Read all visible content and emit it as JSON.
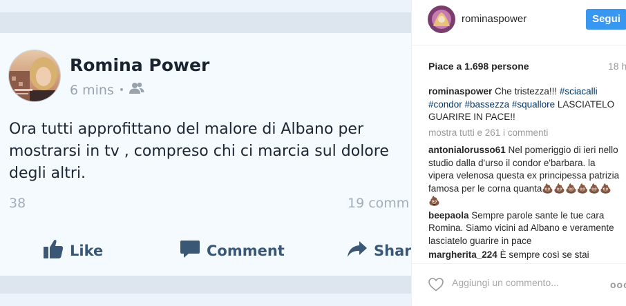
{
  "facebook_post": {
    "author_name": "Romina Power",
    "time": "6 mins",
    "meta_separator": "•",
    "text": "Ora tutti approfittano del malore di Albano per mostrarsi in tv , compreso chi ci marcia sul dolore degli altri.",
    "likes_count": "38",
    "comments_count": "19 comm",
    "actions": {
      "like": "Like",
      "comment": "Comment",
      "share": "Share"
    },
    "icons": [
      "friends-icon",
      "thumbs-up-icon",
      "comment-icon",
      "share-arrow-icon"
    ],
    "colors": {
      "action_text": "#3a5775",
      "card_bg": "#f4fafd"
    }
  },
  "instagram": {
    "header": {
      "username": "rominaspower",
      "follow_label": "Segui"
    },
    "likes_text": "Piace a 1.698 persone",
    "time_ago": "18 h",
    "caption": {
      "user": "rominaspower",
      "text_before": "Che tristezza!!! ",
      "tags": "#sciacalli #condor #bassezza #squallore",
      "text_after": "LASCIATELO GUARIRE IN PACE!!"
    },
    "view_all": "mostra tutti e 261 i commenti",
    "comments": [
      {
        "user": "antonialorusso61",
        "text": "Nel pomeriggio di ieri nello studio dalla d'urso il condor e'barbara. la vipera velenosa questa ex principessa patrizia famosa per le corna quanta💩💩💩💩💩💩💩"
      },
      {
        "user": "beepaola",
        "text": "Sempre parole sante le tue cara Romina. Siamo vicini ad Albano e veramente lasciatelo guarire in pace"
      },
      {
        "user": "margherita_224",
        "text": "È sempre così se stai"
      }
    ],
    "footer": {
      "comment_placeholder": "Aggiungi un commento...",
      "more": "ooo"
    },
    "colors": {
      "follow_button": "#3897f0",
      "hashtag": "#003569"
    }
  }
}
